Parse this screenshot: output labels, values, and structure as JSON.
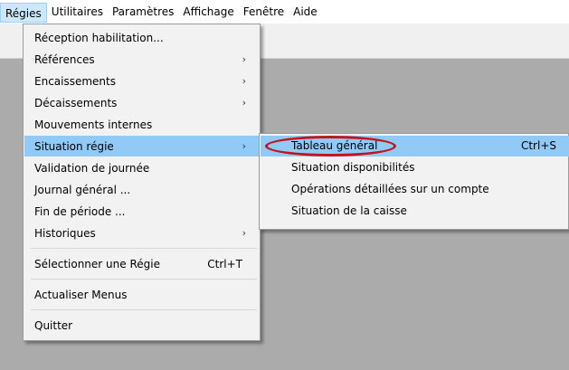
{
  "menubar": {
    "items": [
      "Régies",
      "Utilitaires",
      "Paramètres",
      "Affichage",
      "Fenêtre",
      "Aide"
    ]
  },
  "dropdown": {
    "items": [
      {
        "label": "Réception habilitation...",
        "arrow": "",
        "shortcut": ""
      },
      {
        "label": "Références",
        "arrow": "›",
        "shortcut": ""
      },
      {
        "label": "Encaissements",
        "arrow": "›",
        "shortcut": ""
      },
      {
        "label": "Décaissements",
        "arrow": "›",
        "shortcut": ""
      },
      {
        "label": "Mouvements internes",
        "arrow": "",
        "shortcut": ""
      },
      {
        "label": "Situation régie",
        "arrow": "›",
        "shortcut": ""
      },
      {
        "label": "Validation de journée",
        "arrow": "",
        "shortcut": ""
      },
      {
        "label": "Journal général ...",
        "arrow": "",
        "shortcut": ""
      },
      {
        "label": "Fin de période ...",
        "arrow": "",
        "shortcut": ""
      },
      {
        "label": "Historiques",
        "arrow": "›",
        "shortcut": ""
      },
      {
        "label": "Sélectionner une Régie",
        "arrow": "",
        "shortcut": "Ctrl+T"
      },
      {
        "label": "Actualiser Menus",
        "arrow": "",
        "shortcut": ""
      },
      {
        "label": "Quitter",
        "arrow": "",
        "shortcut": ""
      }
    ]
  },
  "submenu": {
    "items": [
      {
        "label": "Tableau général",
        "shortcut": "Ctrl+S"
      },
      {
        "label": "Situation disponibilités",
        "shortcut": ""
      },
      {
        "label": "Opérations détaillées sur un compte",
        "shortcut": ""
      },
      {
        "label": "Situation de la caisse",
        "shortcut": ""
      }
    ]
  },
  "colors": {
    "highlight": "#91c9f7",
    "annotation_ring": "#c3161c",
    "workspace": "#ababab"
  }
}
